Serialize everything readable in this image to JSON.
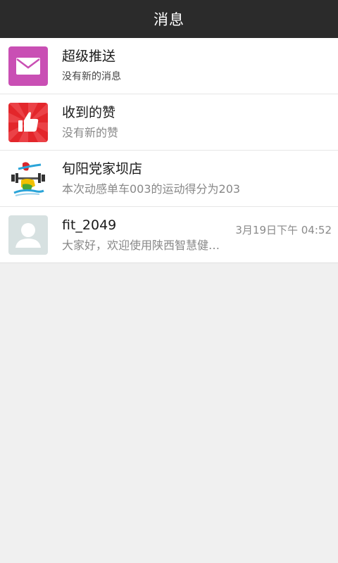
{
  "header": {
    "title": "消息"
  },
  "messages": [
    {
      "title": "超级推送",
      "subtitle": "没有新的消息",
      "time": "",
      "icon": "envelope-icon",
      "color": "#c94fb4"
    },
    {
      "title": "收到的赞",
      "subtitle": "没有新的赞",
      "time": "",
      "icon": "thumbs-up-icon",
      "color": "#e3262b"
    },
    {
      "title": "旬阳党家坝店",
      "subtitle": "本次动感单车003的运动得分为203",
      "time": "",
      "icon": "store-logo-icon",
      "color": "#ffffff"
    },
    {
      "title": "fit_2049",
      "subtitle": "大家好，欢迎使用陕西智慧健…",
      "time": "3月19日下午 04:52",
      "icon": "default-avatar-icon",
      "color": "#d7e1e1"
    }
  ]
}
